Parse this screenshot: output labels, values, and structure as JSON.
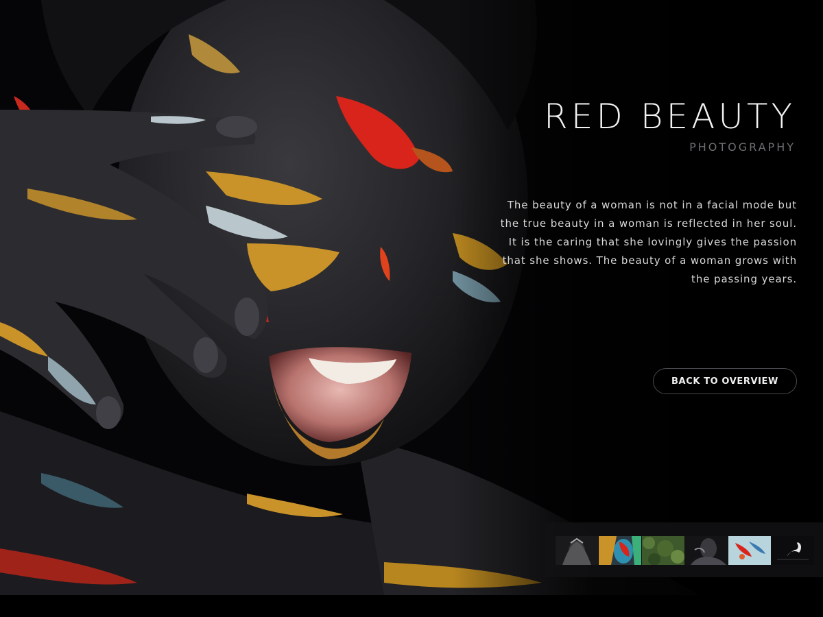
{
  "hero": {
    "title": "RED BEAUTY",
    "subtitle": "PHOTOGRAPHY",
    "description": "The beauty of a woman is not in a facial mode but the true beauty in a woman is reflected in her soul. It is the caring that she lovingly gives the passion that she shows. The beauty of a woman grows with the passing years.",
    "back_button_label": "BACK TO OVERVIEW"
  },
  "gallery": {
    "thumbnails": [
      {
        "name": "thumbnail-hands-over-face"
      },
      {
        "name": "thumbnail-colorful-painted-face"
      },
      {
        "name": "thumbnail-green-foliage"
      },
      {
        "name": "thumbnail-dark-portrait"
      },
      {
        "name": "thumbnail-paint-splash"
      },
      {
        "name": "thumbnail-swan"
      }
    ]
  },
  "colors": {
    "background": "#050507",
    "title": "#f2f2f2",
    "subtitle": "#6f6f72",
    "body_text": "#d9d9d9",
    "button_border": "#4a4a4f",
    "paint_red": "#d8241a",
    "paint_gold": "#c9932a",
    "paint_blue": "#6f8f9c"
  }
}
